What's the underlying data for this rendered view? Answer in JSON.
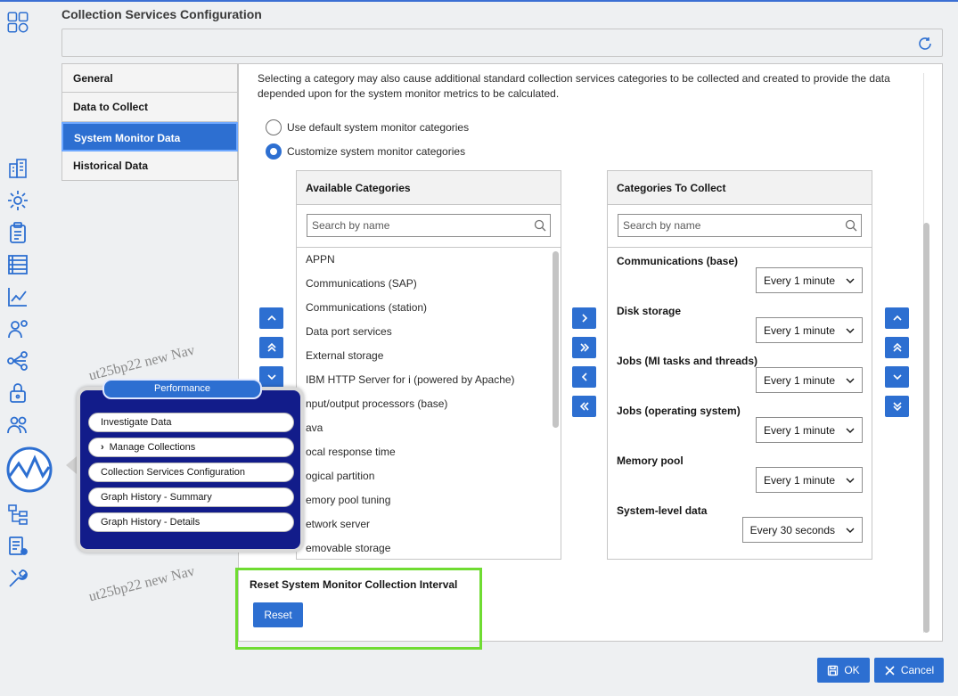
{
  "app": {
    "title": "Collection Services Configuration",
    "accent_color": "#2d6fd1",
    "highlight_color": "#6fdc32"
  },
  "rail_icons": [
    "apps-icon",
    "building-icon",
    "gear-icon",
    "clipboard-icon",
    "database-list-icon",
    "chart-line-icon",
    "user-gear-icon",
    "network-icon",
    "lock-icon",
    "users-icon",
    "performance-icon",
    "hierarchy-icon",
    "report-icon",
    "tools-icon"
  ],
  "nav": {
    "items": [
      {
        "label": "General"
      },
      {
        "label": "Data to Collect"
      },
      {
        "label": "System Monitor Data"
      },
      {
        "label": "Historical Data"
      }
    ],
    "active_index": 2
  },
  "main": {
    "intro": "Selecting a category may also cause additional standard collection services categories to be collected and created to provide the data depended upon for the system monitor metrics to be calculated.",
    "radio_default": "Use default system monitor categories",
    "radio_custom": "Customize system monitor categories",
    "selected_radio": "custom"
  },
  "available": {
    "header": "Available Categories",
    "search_placeholder": "Search by name",
    "items": [
      "APPN",
      "Communications (SAP)",
      "Communications (station)",
      "Data port services",
      "External storage",
      "IBM HTTP Server for i (powered by Apache)",
      "nput/output processors (base)",
      "ava",
      "ocal response time",
      "ogical partition",
      "emory pool tuning",
      "etwork server",
      "emovable storage"
    ]
  },
  "collect": {
    "header": "Categories To Collect",
    "search_placeholder": "Search by name",
    "items": [
      {
        "name": "Communications (base)",
        "interval": "Every 1 minute"
      },
      {
        "name": "Disk storage",
        "interval": "Every 1 minute"
      },
      {
        "name": "Jobs (MI tasks and threads)",
        "interval": "Every 1 minute"
      },
      {
        "name": "Jobs (operating system)",
        "interval": "Every 1 minute"
      },
      {
        "name": "Memory pool",
        "interval": "Every 1 minute"
      },
      {
        "name": "System-level data",
        "interval": "Every 30 seconds"
      }
    ]
  },
  "reset": {
    "title": "Reset System Monitor Collection Interval",
    "button": "Reset"
  },
  "footer": {
    "ok": "OK",
    "cancel": "Cancel"
  },
  "watermark": "ut25bp22 new Nav",
  "popup": {
    "title": "Performance",
    "items": [
      {
        "label": "Investigate Data"
      },
      {
        "label": "Manage Collections"
      },
      {
        "label": "Collection Services Configuration"
      },
      {
        "label": "Graph History - Summary"
      },
      {
        "label": "Graph History - Details"
      }
    ]
  }
}
